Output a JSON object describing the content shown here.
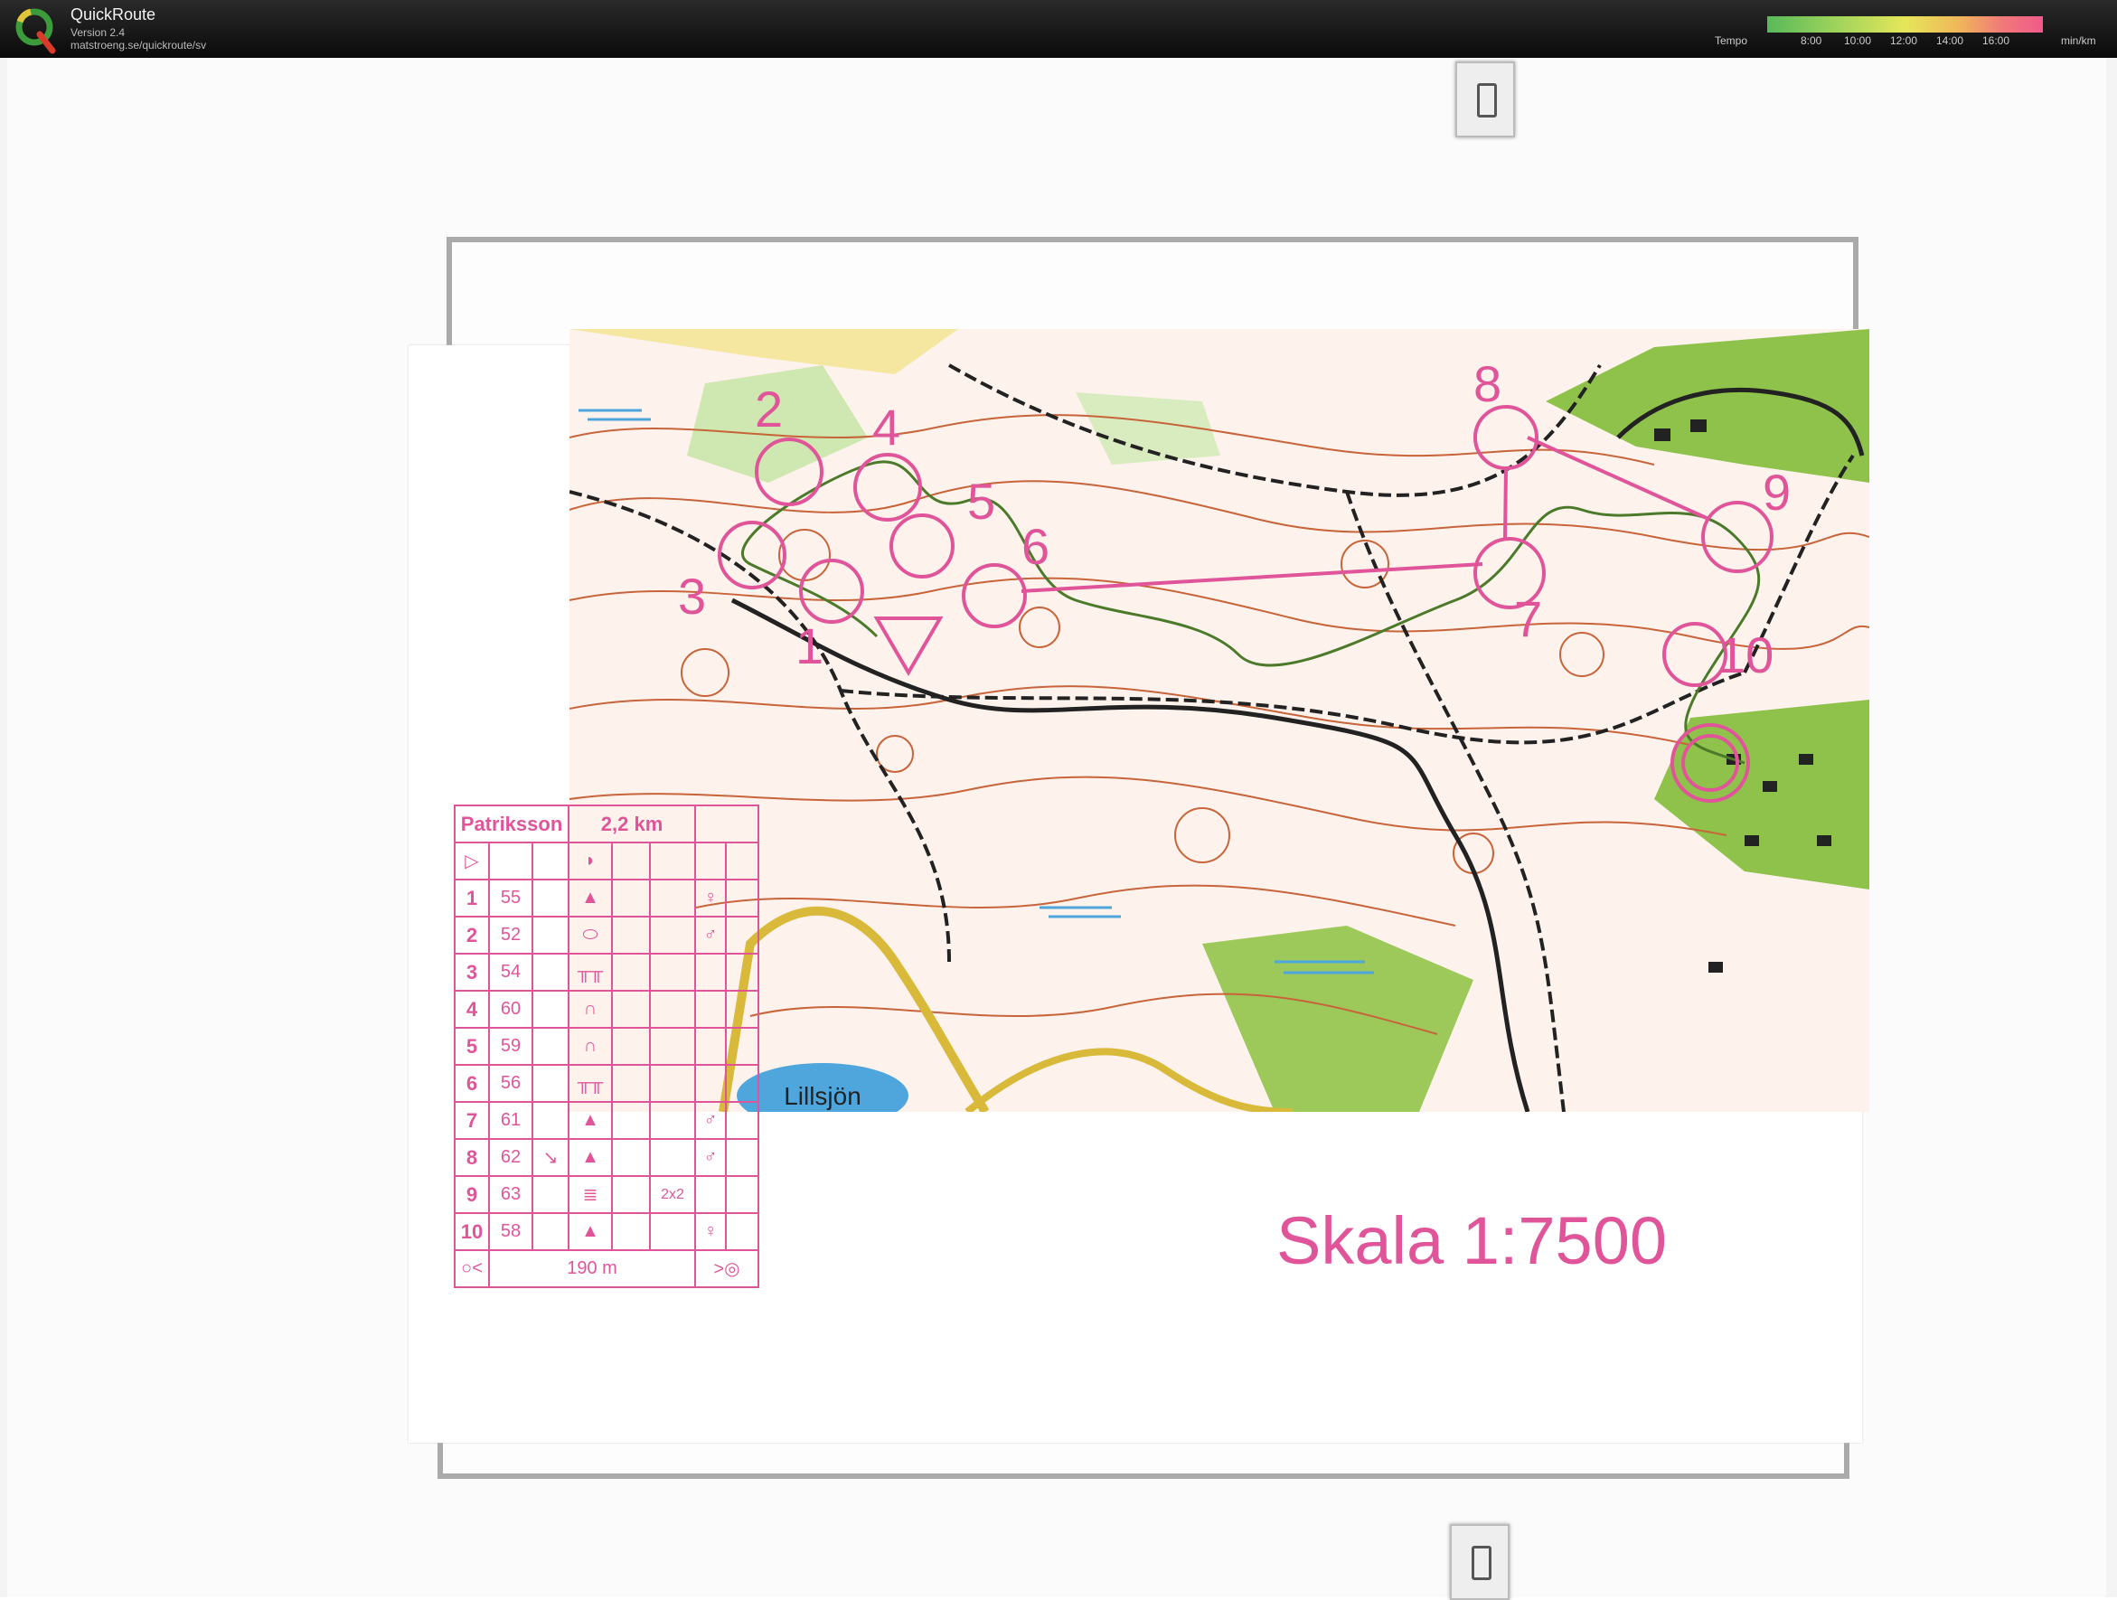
{
  "app": {
    "title": "QuickRoute",
    "version": "Version 2.4",
    "url": "matstroeng.se/quickroute/sv",
    "logo_letter": "Q"
  },
  "tempo": {
    "label": "Tempo",
    "ticks": [
      "8:00",
      "10:00",
      "12:00",
      "14:00",
      "16:00"
    ],
    "unit": "min/km"
  },
  "map": {
    "scale_text": "Skala 1:7500",
    "lake_label": "Lillsjön",
    "control_numbers": [
      "1",
      "2",
      "3",
      "4",
      "5",
      "6",
      "7",
      "8",
      "9",
      "10"
    ],
    "colors": {
      "course": "#e0559a",
      "route": "#4a7a2a",
      "contour": "#c8643a"
    }
  },
  "card": {
    "name": "Patriksson",
    "length": "2,2 km",
    "rows": [
      {
        "n": "1",
        "code": "55",
        "extra": ""
      },
      {
        "n": "2",
        "code": "52",
        "extra": ""
      },
      {
        "n": "3",
        "code": "54",
        "extra": ""
      },
      {
        "n": "4",
        "code": "60",
        "extra": ""
      },
      {
        "n": "5",
        "code": "59",
        "extra": ""
      },
      {
        "n": "6",
        "code": "56",
        "extra": ""
      },
      {
        "n": "7",
        "code": "61",
        "extra": ""
      },
      {
        "n": "8",
        "code": "62",
        "extra": ""
      },
      {
        "n": "9",
        "code": "63",
        "extra": "2x2"
      },
      {
        "n": "10",
        "code": "58",
        "extra": ""
      }
    ],
    "finish": "190 m"
  }
}
